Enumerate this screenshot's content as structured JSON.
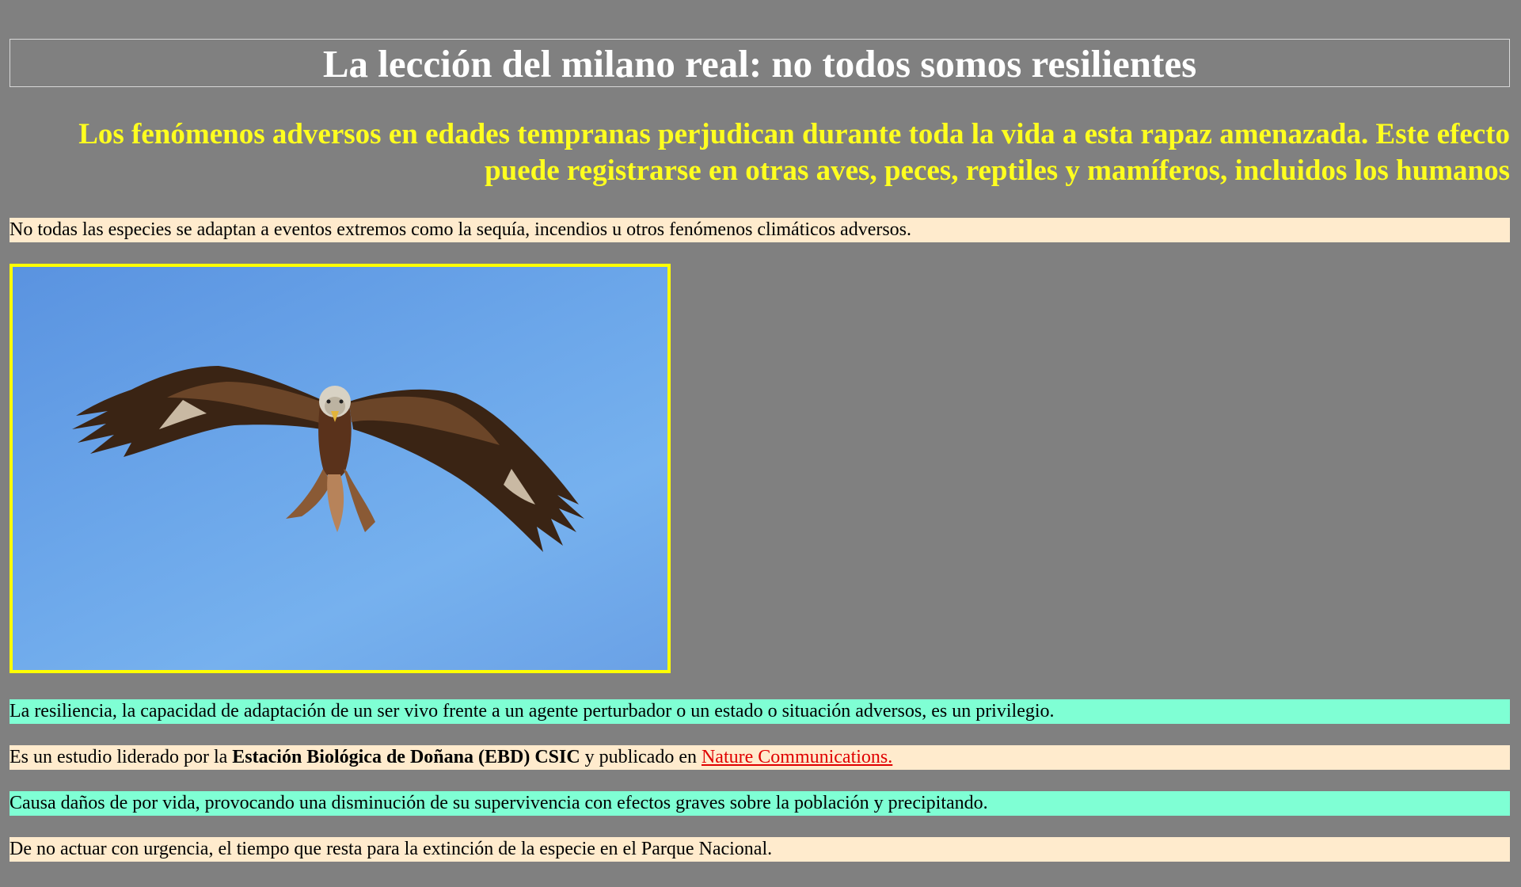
{
  "article": {
    "title": "La lección del milano real: no todos somos resilientes",
    "subtitle": "Los fenómenos adversos en edades tempranas perjudican durante toda la vida a esta rapaz amenazada. Este efecto puede registrarse en otras aves, peces, reptiles y mamíferos, incluidos los humanos",
    "intro": "No todas las especies se adaptan a eventos extremos como la sequía, incendios u otros fenómenos climáticos adversos.",
    "image": {
      "subject": "red-kite-in-flight",
      "border_color": "#ffff00",
      "sky_color": "#6aa6e8"
    },
    "paragraphs": {
      "resilience": "La resiliencia, la capacidad de adaptación de un ser vivo frente a un agente perturbador o un estado o situación adversos, es un privilegio.",
      "study_prefix": "Es un estudio liderado por la ",
      "study_institution": "Estación Biológica de Doñana (EBD) CSIC",
      "study_middle": " y publicado en ",
      "study_link": "Nature Communications.",
      "damage": "Causa daños de por vida, provocando una disminución de su supervivencia con efectos graves sobre la población y precipitando.",
      "urgency": "De no actuar con urgencia, el tiempo que resta para la extinción de la especie en el Parque Nacional."
    }
  },
  "colors": {
    "page_background": "#808080",
    "title_color": "#ffffff",
    "subtitle_color": "#ffff1f",
    "cream_band": "#ffebcd",
    "aqua_band": "#7fffd4",
    "link_color": "#e00000"
  }
}
